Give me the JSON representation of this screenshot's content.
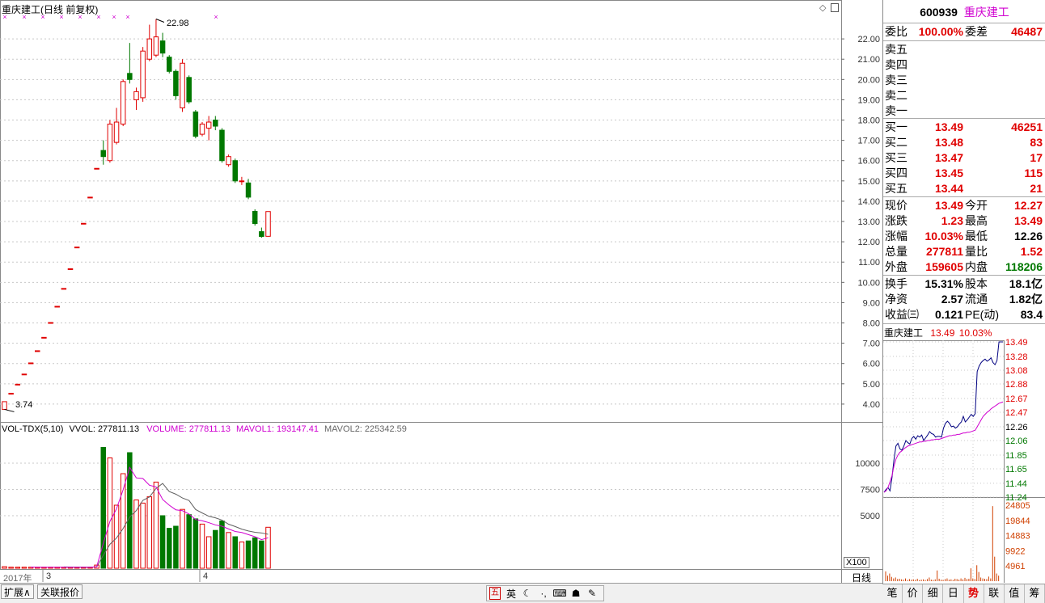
{
  "colors": {
    "up": "#e00000",
    "down": "#007800",
    "mavol1": "#d000d0",
    "mavol2": "#606060",
    "intraday_price": "#000080",
    "intraday_avg": "#d000d0",
    "intraday_volume": "#d04000",
    "grid": "#c8c8c8"
  },
  "main": {
    "title": "重庆建工(日线 前复权)",
    "high_label": "22.98",
    "low_label": "3.74",
    "y_ticks": [
      "22.00",
      "21.00",
      "20.00",
      "19.00",
      "18.00",
      "17.00",
      "16.00",
      "15.00",
      "14.00",
      "13.00",
      "12.00",
      "11.00",
      "10.00",
      "9.00",
      "8.00",
      "7.00",
      "6.00",
      "5.00",
      "4.00"
    ]
  },
  "volume": {
    "indicator": "VOL-TDX(5,10)",
    "vvol": "VVOL: 277811.13",
    "volume_label": "VOLUME: 277811.13",
    "mavol1_label": "MAVOL1: 193147.41",
    "mavol2_label": "MAVOL2: 225342.59",
    "y_ticks": [
      "10000",
      "7500",
      "5000"
    ],
    "unit": "X100"
  },
  "x_axis": {
    "labels": [
      "2017年",
      "3",
      "4"
    ],
    "period": "日线"
  },
  "bottom_tabs": [
    "扩展∧",
    "关联报价"
  ],
  "ime_icons": [
    "五",
    "英",
    "moon-icon",
    "dot-icon",
    "keyboard-icon",
    "user-icon",
    "wrench-icon"
  ],
  "quote": {
    "code": "600939",
    "name": "重庆建工",
    "weibi_label": "委比",
    "weibi": "100.00%",
    "weicha_label": "委差",
    "weicha": "46487",
    "sell": [
      {
        "label": "卖五",
        "price": "",
        "vol": ""
      },
      {
        "label": "卖四",
        "price": "",
        "vol": ""
      },
      {
        "label": "卖三",
        "price": "",
        "vol": ""
      },
      {
        "label": "卖二",
        "price": "",
        "vol": ""
      },
      {
        "label": "卖一",
        "price": "",
        "vol": ""
      }
    ],
    "buy": [
      {
        "label": "买一",
        "price": "13.49",
        "vol": "46251"
      },
      {
        "label": "买二",
        "price": "13.48",
        "vol": "83"
      },
      {
        "label": "买三",
        "price": "13.47",
        "vol": "17"
      },
      {
        "label": "买四",
        "price": "13.45",
        "vol": "115"
      },
      {
        "label": "买五",
        "price": "13.44",
        "vol": "21"
      }
    ],
    "stats1": [
      {
        "l1": "现价",
        "v1": "13.49",
        "c1": "red",
        "l2": "今开",
        "v2": "12.27",
        "c2": "red"
      },
      {
        "l1": "涨跌",
        "v1": "1.23",
        "c1": "red",
        "l2": "最高",
        "v2": "13.49",
        "c2": "red"
      },
      {
        "l1": "涨幅",
        "v1": "10.03%",
        "c1": "red",
        "l2": "最低",
        "v2": "12.26",
        "c2": "black"
      },
      {
        "l1": "总量",
        "v1": "277811",
        "c1": "red",
        "l2": "量比",
        "v2": "1.52",
        "c2": "red"
      },
      {
        "l1": "外盘",
        "v1": "159605",
        "c1": "red",
        "l2": "内盘",
        "v2": "118206",
        "c2": "green"
      }
    ],
    "stats2": [
      {
        "l1": "换手",
        "v1": "15.31%",
        "l2": "股本",
        "v2": "18.1亿"
      },
      {
        "l1": "净资",
        "v1": "2.57",
        "l2": "流通",
        "v2": "1.82亿"
      },
      {
        "l1": "收益㈢",
        "v1": "0.121",
        "l2": "PE(动)",
        "v2": "83.4"
      }
    ],
    "mini_title": "重庆建工",
    "mini_price": "13.49",
    "mini_pct": "10.03%",
    "mini_price_ticks": [
      "13.49",
      "13.28",
      "13.08",
      "12.88",
      "12.67",
      "12.47",
      "12.26",
      "12.06",
      "11.85",
      "11.65",
      "11.44",
      "11.24"
    ],
    "mini_vol_ticks": [
      "24805",
      "19844",
      "14883",
      "9922",
      "4961"
    ],
    "tabs": [
      "笔",
      "价",
      "细",
      "日",
      "势",
      "联",
      "值",
      "筹"
    ],
    "active_tab": "势"
  },
  "chart_data": [
    {
      "type": "candlestick",
      "title": "重庆建工(日线 前复权)",
      "ylim": [
        3.2,
        23.2
      ],
      "x": [
        "2017年",
        "3",
        "4"
      ],
      "candles": [
        {
          "o": 3.74,
          "c": 4.12,
          "h": 4.12,
          "l": 3.74
        },
        {
          "o": 4.53,
          "c": 4.53,
          "h": 4.53,
          "l": 4.53
        },
        {
          "o": 4.98,
          "c": 4.98,
          "h": 4.98,
          "l": 4.98
        },
        {
          "o": 5.48,
          "c": 5.48,
          "h": 5.48,
          "l": 5.48
        },
        {
          "o": 6.03,
          "c": 6.03,
          "h": 6.03,
          "l": 6.03
        },
        {
          "o": 6.63,
          "c": 6.63,
          "h": 6.63,
          "l": 6.63
        },
        {
          "o": 7.29,
          "c": 7.29,
          "h": 7.29,
          "l": 7.29
        },
        {
          "o": 8.02,
          "c": 8.02,
          "h": 8.02,
          "l": 8.02
        },
        {
          "o": 8.82,
          "c": 8.82,
          "h": 8.82,
          "l": 8.82
        },
        {
          "o": 9.7,
          "c": 9.7,
          "h": 9.7,
          "l": 9.7
        },
        {
          "o": 10.67,
          "c": 10.67,
          "h": 10.67,
          "l": 10.67
        },
        {
          "o": 11.74,
          "c": 11.74,
          "h": 11.74,
          "l": 11.74
        },
        {
          "o": 12.91,
          "c": 12.91,
          "h": 12.91,
          "l": 12.91
        },
        {
          "o": 14.2,
          "c": 14.2,
          "h": 14.2,
          "l": 14.2
        },
        {
          "o": 15.62,
          "c": 15.62,
          "h": 15.62,
          "l": 15.62
        },
        {
          "o": 16.5,
          "c": 16.2,
          "h": 17.0,
          "l": 15.8
        },
        {
          "o": 16.0,
          "c": 17.8,
          "h": 18.0,
          "l": 15.9
        },
        {
          "o": 16.9,
          "c": 17.9,
          "h": 18.6,
          "l": 16.8
        },
        {
          "o": 17.8,
          "c": 19.9,
          "h": 20.0,
          "l": 17.7
        },
        {
          "o": 20.3,
          "c": 20.0,
          "h": 21.8,
          "l": 19.8
        },
        {
          "o": 19.0,
          "c": 19.4,
          "h": 19.6,
          "l": 18.5
        },
        {
          "o": 19.1,
          "c": 21.4,
          "h": 21.6,
          "l": 18.9
        },
        {
          "o": 21.0,
          "c": 22.0,
          "h": 22.7,
          "l": 20.9
        },
        {
          "o": 21.2,
          "c": 22.1,
          "h": 22.98,
          "l": 21.1
        },
        {
          "o": 21.9,
          "c": 21.3,
          "h": 22.3,
          "l": 21.1
        },
        {
          "o": 21.1,
          "c": 20.4,
          "h": 21.2,
          "l": 20.3
        },
        {
          "o": 20.4,
          "c": 19.2,
          "h": 20.5,
          "l": 19.0
        },
        {
          "o": 18.6,
          "c": 20.8,
          "h": 21.0,
          "l": 18.4
        },
        {
          "o": 20.1,
          "c": 18.9,
          "h": 20.2,
          "l": 18.8
        },
        {
          "o": 18.4,
          "c": 17.2,
          "h": 18.5,
          "l": 17.1
        },
        {
          "o": 17.3,
          "c": 17.8,
          "h": 17.9,
          "l": 17.2
        },
        {
          "o": 17.6,
          "c": 17.9,
          "h": 18.2,
          "l": 17.0
        },
        {
          "o": 18.0,
          "c": 17.7,
          "h": 18.2,
          "l": 17.5
        },
        {
          "o": 17.5,
          "c": 16.0,
          "h": 17.6,
          "l": 15.9
        },
        {
          "o": 15.8,
          "c": 16.2,
          "h": 16.3,
          "l": 15.7
        },
        {
          "o": 16.0,
          "c": 15.0,
          "h": 16.1,
          "l": 14.9
        },
        {
          "o": 15.0,
          "c": 15.0,
          "h": 15.2,
          "l": 14.8
        },
        {
          "o": 14.9,
          "c": 14.2,
          "h": 15.1,
          "l": 14.1
        },
        {
          "o": 13.5,
          "c": 12.9,
          "h": 13.6,
          "l": 12.8
        },
        {
          "o": 12.5,
          "c": 12.26,
          "h": 12.7,
          "l": 12.2
        },
        {
          "o": 12.27,
          "c": 13.49,
          "h": 13.49,
          "l": 12.26
        }
      ]
    },
    {
      "type": "bar",
      "title": "VOL-TDX(5,10)",
      "ylim": [
        0,
        11000
      ],
      "values": [
        150,
        100,
        100,
        100,
        100,
        100,
        100,
        100,
        100,
        100,
        100,
        100,
        100,
        100,
        300,
        11500,
        10500,
        6000,
        9000,
        11000,
        6500,
        6200,
        6800,
        8200,
        5000,
        3800,
        4000,
        5600,
        5100,
        4700,
        4200,
        3000,
        3600,
        4500,
        3400,
        3000,
        2500,
        2600,
        2900,
        2600,
        3900
      ],
      "mavol1": [
        null,
        null,
        null,
        null,
        120,
        100,
        100,
        100,
        100,
        100,
        100,
        100,
        100,
        100,
        140,
        2380,
        4460,
        5660,
        7460,
        9600,
        8600,
        8540,
        7900,
        7740,
        6540,
        6000,
        5560,
        5480,
        5160,
        4640,
        4520,
        4340,
        4120,
        4000,
        3740,
        3500,
        3400,
        3200,
        3000,
        2720,
        2900
      ],
      "mavol2": [
        null,
        null,
        null,
        null,
        null,
        null,
        null,
        null,
        null,
        125,
        120,
        100,
        100,
        100,
        120,
        1240,
        2280,
        2880,
        3780,
        4870,
        5490,
        6460,
        6780,
        7600,
        8070,
        7300,
        7050,
        6690,
        6450,
        5590,
        5260,
        4950,
        4800,
        4580,
        4190,
        3970,
        3720,
        3550,
        3420,
        3360,
        3230
      ]
    },
    {
      "type": "line",
      "title": "重庆建工",
      "ylim": [
        11.24,
        13.49
      ],
      "series_price": [
        11.31,
        11.35,
        11.38,
        11.33,
        11.52,
        11.78,
        11.98,
        12.02,
        11.94,
        11.92,
        11.98,
        12.06,
        12.03,
        12.01,
        12.09,
        12.12,
        12.08,
        12.13,
        12.11,
        12.14,
        12.06,
        12.1,
        12.14,
        12.19,
        12.16,
        12.15,
        12.11,
        12.12,
        12.12,
        12.11,
        12.24,
        12.31,
        12.34,
        12.31,
        12.26,
        12.27,
        12.24,
        12.26,
        12.3,
        12.33,
        12.41,
        12.33,
        12.36,
        12.4,
        12.44,
        12.41,
        12.45,
        13.06,
        13.14,
        13.19,
        13.22,
        13.24,
        13.21,
        13.23,
        13.26,
        13.19,
        13.16,
        13.22,
        13.49,
        13.49,
        13.49
      ],
      "series_avg": [
        11.31,
        11.33,
        11.38,
        11.46,
        11.55,
        11.69,
        11.79,
        11.85,
        11.89,
        11.91,
        11.94,
        11.96,
        11.98,
        11.99,
        12.0,
        12.01,
        12.02,
        12.03,
        12.04,
        12.04,
        12.05,
        12.05,
        12.06,
        12.06,
        12.07,
        12.07,
        12.08,
        12.08,
        12.08,
        12.09,
        12.1,
        12.11,
        12.12,
        12.13,
        12.13,
        12.14,
        12.14,
        12.15,
        12.15,
        12.16,
        12.17,
        12.17,
        12.18,
        12.18,
        12.19,
        12.2,
        12.21,
        12.26,
        12.31,
        12.36,
        12.41,
        12.44,
        12.47,
        12.49,
        12.52,
        12.54,
        12.56,
        12.58,
        12.6,
        12.61,
        12.62
      ]
    }
  ]
}
